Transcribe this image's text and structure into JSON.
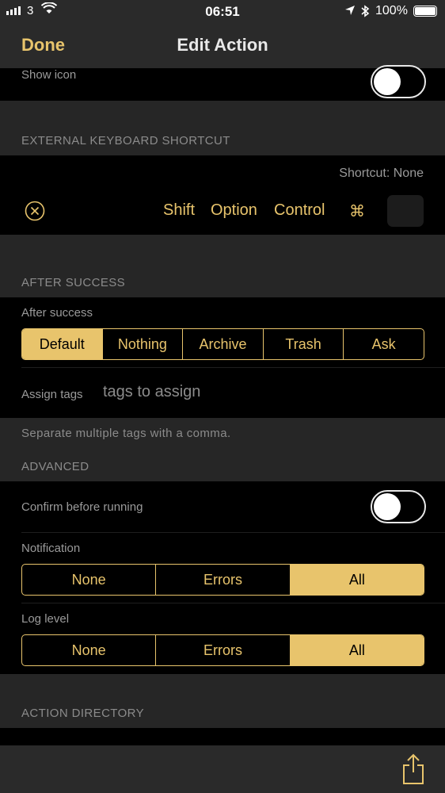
{
  "status": {
    "carrier": "3",
    "time": "06:51",
    "battery": "100%"
  },
  "nav": {
    "done": "Done",
    "title": "Edit Action"
  },
  "show_icon": {
    "label": "Show icon"
  },
  "keyboard": {
    "header": "EXTERNAL KEYBOARD SHORTCUT",
    "shortcut_text": "Shortcut: None",
    "modifiers": [
      "Shift",
      "Option",
      "Control",
      "⌘"
    ]
  },
  "after_success": {
    "header": "AFTER SUCCESS",
    "label": "After success",
    "options": [
      "Default",
      "Nothing",
      "Archive",
      "Trash",
      "Ask"
    ],
    "selected": "Default",
    "assign_tags_label": "Assign tags",
    "assign_tags_placeholder": "tags to assign",
    "footer": "Separate multiple tags with a comma."
  },
  "advanced": {
    "header": "ADVANCED",
    "confirm_label": "Confirm before running",
    "notification_label": "Notification",
    "notification_options": [
      "None",
      "Errors",
      "All"
    ],
    "notification_selected": "All",
    "log_label": "Log level",
    "log_options": [
      "None",
      "Errors",
      "All"
    ],
    "log_selected": "All"
  },
  "directory": {
    "header": "ACTION DIRECTORY"
  },
  "colors": {
    "accent": "#e8c46c",
    "background": "#262626",
    "cell": "#000000"
  },
  "icons": {
    "clear": "circle-x-icon",
    "share": "share-icon",
    "location": "location-arrow-icon",
    "bluetooth": "bluetooth-icon"
  }
}
